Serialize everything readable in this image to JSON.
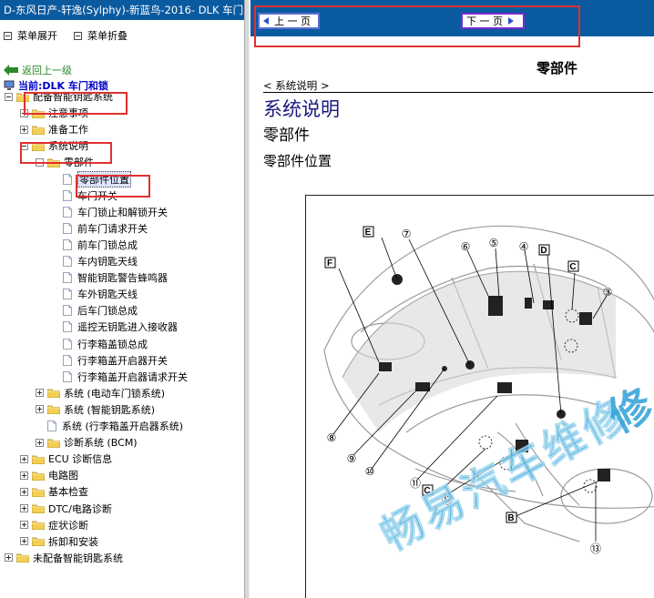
{
  "window": {
    "title": "D-东风日产-轩逸(Sylphy)-新蓝鸟-2016- DLK 车门"
  },
  "menu": {
    "expand_label": "菜单展开",
    "collapse_label": "菜单折叠"
  },
  "nav": {
    "back_label": "返回上一级",
    "current_label": "当前:DLK 车门和锁"
  },
  "tree": [
    {
      "label": "配备智能钥匙系统",
      "level": 0,
      "type": "folder",
      "expanded": true
    },
    {
      "label": "注意事项",
      "level": 1,
      "type": "folder",
      "expanded": false
    },
    {
      "label": "准备工作",
      "level": 1,
      "type": "folder",
      "expanded": false
    },
    {
      "label": "系统说明",
      "level": 1,
      "type": "folder",
      "expanded": true
    },
    {
      "label": "零部件",
      "level": 2,
      "type": "folder",
      "expanded": true
    },
    {
      "label": "零部件位置",
      "level": 3,
      "type": "doc",
      "selected": true
    },
    {
      "label": "车门开关",
      "level": 3,
      "type": "doc"
    },
    {
      "label": "车门锁止和解锁开关",
      "level": 3,
      "type": "doc"
    },
    {
      "label": "前车门请求开关",
      "level": 3,
      "type": "doc"
    },
    {
      "label": "前车门锁总成",
      "level": 3,
      "type": "doc"
    },
    {
      "label": "车内钥匙天线",
      "level": 3,
      "type": "doc"
    },
    {
      "label": "智能钥匙警告蜂鸣器",
      "level": 3,
      "type": "doc"
    },
    {
      "label": "车外钥匙天线",
      "level": 3,
      "type": "doc"
    },
    {
      "label": "后车门锁总成",
      "level": 3,
      "type": "doc"
    },
    {
      "label": "遥控无钥匙进入接收器",
      "level": 3,
      "type": "doc"
    },
    {
      "label": "行李箱盖锁总成",
      "level": 3,
      "type": "doc"
    },
    {
      "label": "行李箱盖开启器开关",
      "level": 3,
      "type": "doc"
    },
    {
      "label": "行李箱盖开启器请求开关",
      "level": 3,
      "type": "doc"
    },
    {
      "label": "系统 (电动车门锁系统)",
      "level": 2,
      "type": "folder",
      "expanded": false
    },
    {
      "label": "系统 (智能钥匙系统)",
      "level": 2,
      "type": "folder",
      "expanded": false
    },
    {
      "label": "系统 (行李箱盖开启器系统)",
      "level": 2,
      "type": "doc"
    },
    {
      "label": "诊断系统 (BCM)",
      "level": 2,
      "type": "folder",
      "expanded": false
    },
    {
      "label": "ECU 诊断信息",
      "level": 1,
      "type": "folder",
      "expanded": false
    },
    {
      "label": "电路图",
      "level": 1,
      "type": "folder",
      "expanded": false
    },
    {
      "label": "基本检查",
      "level": 1,
      "type": "folder",
      "expanded": false
    },
    {
      "label": "DTC/电路诊断",
      "level": 1,
      "type": "folder",
      "expanded": false
    },
    {
      "label": "症状诊断",
      "level": 1,
      "type": "folder",
      "expanded": false
    },
    {
      "label": "拆卸和安装",
      "level": 1,
      "type": "folder",
      "expanded": false
    },
    {
      "label": "未配备智能钥匙系统",
      "level": 0,
      "type": "folder",
      "expanded": false
    }
  ],
  "toolbar": {
    "prev_label": "上 一 页",
    "next_label": "下 一 页"
  },
  "content": {
    "page_heading": "零部件",
    "breadcrumb": "< 系统说明 >",
    "section_title": "系统说明",
    "sub_title": "零部件",
    "sub_sub_title": "零部件位置"
  },
  "diagram": {
    "callouts_letter": [
      "E",
      "F",
      "D",
      "C",
      "C",
      "B"
    ],
    "callouts_number": [
      "⑦",
      "⑥",
      "⑤",
      "④",
      "③",
      "⑧",
      "⑨",
      "⑩",
      "⑪",
      "⑫",
      "⑬"
    ]
  },
  "watermark": {
    "text": "畅易汽车维修",
    "text_top": "修"
  },
  "colors": {
    "title_bar": "#0a5aa0",
    "highlight": "#e03030",
    "link_green": "#2a8a2a",
    "current_blue": "#0000cc"
  }
}
